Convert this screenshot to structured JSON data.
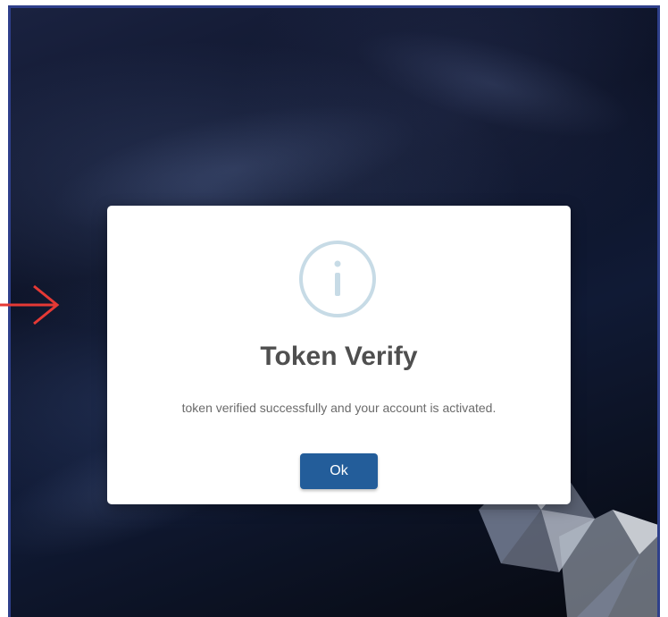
{
  "modal": {
    "icon": "info-icon",
    "title": "Token Verify",
    "message": "token verified successfully and your account is activated.",
    "ok_label": "Ok"
  },
  "colors": {
    "frame_border": "#2e3f8a",
    "arrow": "#e53935",
    "button": "#235d9a",
    "icon_ring": "#c7dbe6"
  }
}
